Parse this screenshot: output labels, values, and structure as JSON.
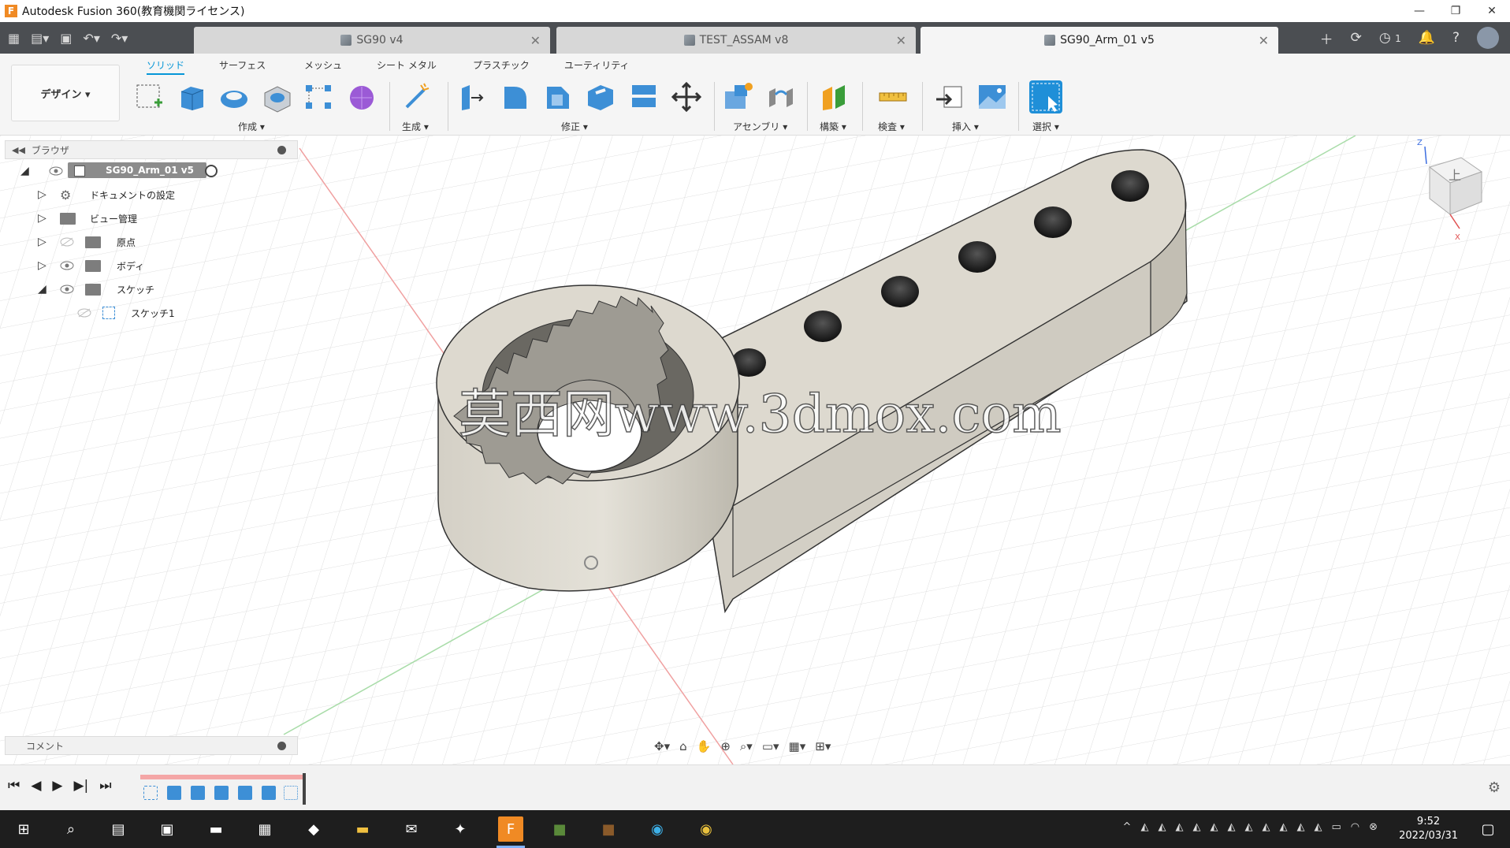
{
  "window": {
    "title": "Autodesk Fusion 360(教育機関ライセンス)",
    "app_icon": "F",
    "minimize": "—",
    "restore": "❐",
    "close": "✕"
  },
  "tabs": [
    {
      "label": "SG90 v4",
      "active": false
    },
    {
      "label": "TEST_ASSAM v8",
      "active": false
    },
    {
      "label": "SG90_Arm_01 v5",
      "active": true
    }
  ],
  "tab_toolbar": {
    "notifications_count": "1"
  },
  "ribbon": {
    "workspace": "デザイン ▾",
    "tabs": [
      "ソリッド",
      "サーフェス",
      "メッシュ",
      "シート メタル",
      "プラスチック",
      "ユーティリティ"
    ],
    "groups": [
      "作成 ▾",
      "生成 ▾",
      "修正 ▾",
      "アセンブリ ▾",
      "構築 ▾",
      "検査 ▾",
      "挿入 ▾",
      "選択 ▾"
    ]
  },
  "browser": {
    "title": "ブラウザ",
    "root": "SG90_Arm_01 v5",
    "items": [
      {
        "label": "ドキュメントの設定"
      },
      {
        "label": "ビュー管理"
      },
      {
        "label": "原点"
      },
      {
        "label": "ボディ"
      },
      {
        "label": "スケッチ"
      },
      {
        "label": "スケッチ1"
      }
    ]
  },
  "comments": {
    "title": "コメント"
  },
  "watermark": "莫西网www.3dmox.com",
  "viewcube": {
    "face": "上",
    "axis_z": "Z",
    "axis_x": "X"
  },
  "taskbar": {
    "time": "9:52",
    "date": "2022/03/31"
  },
  "colors": {
    "accent": "#0696d7",
    "model": "#ddd9cf",
    "tabstrip": "#4b4e52",
    "taskbar": "#1e1e1e",
    "timeline_bar": "#f4a6a6"
  }
}
